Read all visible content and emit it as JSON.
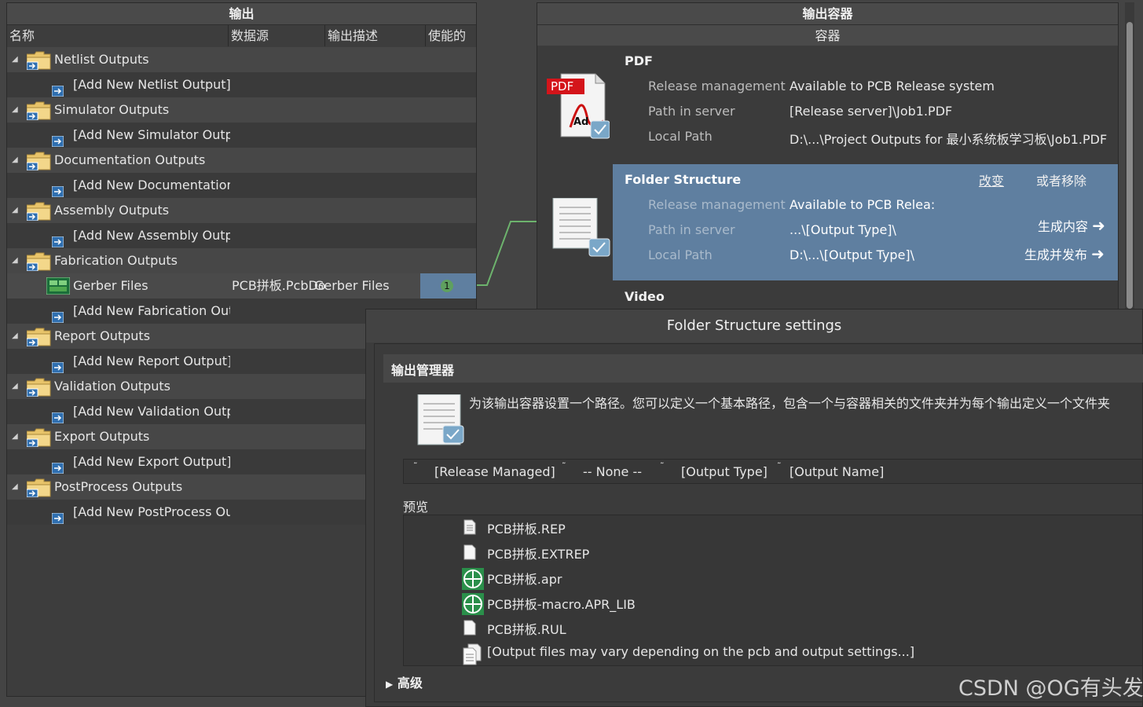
{
  "outputs_panel": {
    "title": "输出",
    "columns": [
      "名称",
      "数据源",
      "输出描述",
      "使能的"
    ],
    "rows": [
      {
        "kind": "category",
        "label": "Netlist Outputs"
      },
      {
        "kind": "add",
        "label": "[Add New Netlist Output]"
      },
      {
        "kind": "category",
        "label": "Simulator Outputs"
      },
      {
        "kind": "add",
        "label": "[Add New Simulator Outp"
      },
      {
        "kind": "category",
        "label": "Documentation Outputs"
      },
      {
        "kind": "add",
        "label": "[Add New Documentation"
      },
      {
        "kind": "category",
        "label": "Assembly Outputs"
      },
      {
        "kind": "add",
        "label": "[Add New Assembly Outpu"
      },
      {
        "kind": "category",
        "label": "Fabrication Outputs"
      },
      {
        "kind": "output",
        "label": "Gerber Files",
        "data_source": "PCB拼板.PcbDo",
        "description": "Gerber Files",
        "enabled_badge": "1"
      },
      {
        "kind": "add",
        "label": "[Add New Fabrication Out"
      },
      {
        "kind": "category",
        "label": "Report Outputs"
      },
      {
        "kind": "add",
        "label": "[Add New Report Output]"
      },
      {
        "kind": "category",
        "label": "Validation Outputs"
      },
      {
        "kind": "add",
        "label": "[Add New Validation Outp"
      },
      {
        "kind": "category",
        "label": "Export Outputs"
      },
      {
        "kind": "add",
        "label": "[Add New Export Output]"
      },
      {
        "kind": "category",
        "label": "PostProcess Outputs"
      },
      {
        "kind": "add",
        "label": "[Add New PostProcess Ou"
      }
    ]
  },
  "containers_panel": {
    "title": "输出容器",
    "subheader": "容器",
    "pdf": {
      "name": "PDF",
      "icon": "pdf-icon",
      "icon_text": "PDF",
      "icon_brand": "Adobe",
      "fields": [
        {
          "label": "Release management",
          "value": "Available to PCB Release system"
        },
        {
          "label": "Path in server",
          "value": "[Release server]\\Job1.PDF"
        },
        {
          "label": "Local Path",
          "value": "D:\\...\\Project Outputs for 最小系统板学习板\\Job1.PDF"
        }
      ]
    },
    "folder": {
      "name": "Folder Structure",
      "change_label": "改变",
      "remove_label": "或者移除",
      "fields": [
        {
          "label": "Release management",
          "value": "Available to PCB Relea:"
        },
        {
          "label": "Path in server",
          "value": "...\\[Output Type]\\"
        },
        {
          "label": "Local Path",
          "value": "D:\\...\\[Output Type]\\"
        }
      ],
      "generate_label": "生成内容",
      "publish_label": "生成并发布",
      "selected_color": "#5f7fa0"
    },
    "video": {
      "name": "Video"
    }
  },
  "dialog": {
    "title": "Folder Structure settings",
    "section_title": "输出管理器",
    "description": "为该输出容器设置一个路径。您可以定义一个基本路径，包含一个与容器相关的文件夹并为每个输出定义一个文件夹",
    "path_segments": [
      "[Release Managed]",
      "-- None --",
      "[Output Type]",
      "[Output Name]"
    ],
    "preview_label": "预览",
    "preview_files": [
      {
        "icon": "document-icon",
        "name": "PCB拼板.REP"
      },
      {
        "icon": "blank-file-icon",
        "name": "PCB拼板.EXTREP"
      },
      {
        "icon": "pcb-globe-icon",
        "name": "PCB拼板.apr"
      },
      {
        "icon": "pcb-globe-icon",
        "name": "PCB拼板-macro.APR_LIB"
      },
      {
        "icon": "blank-file-icon",
        "name": "PCB拼板.RUL"
      },
      {
        "icon": "multi-file-icon",
        "name": "[Output files may vary depending on the pcb and output settings...]"
      }
    ],
    "advanced_label": "高级"
  },
  "watermark": "CSDN @OG有头发",
  "colors": {
    "link_line": "#6db36d",
    "badge": "#5fa05f",
    "enabled_cell": "#5f7fa0"
  }
}
